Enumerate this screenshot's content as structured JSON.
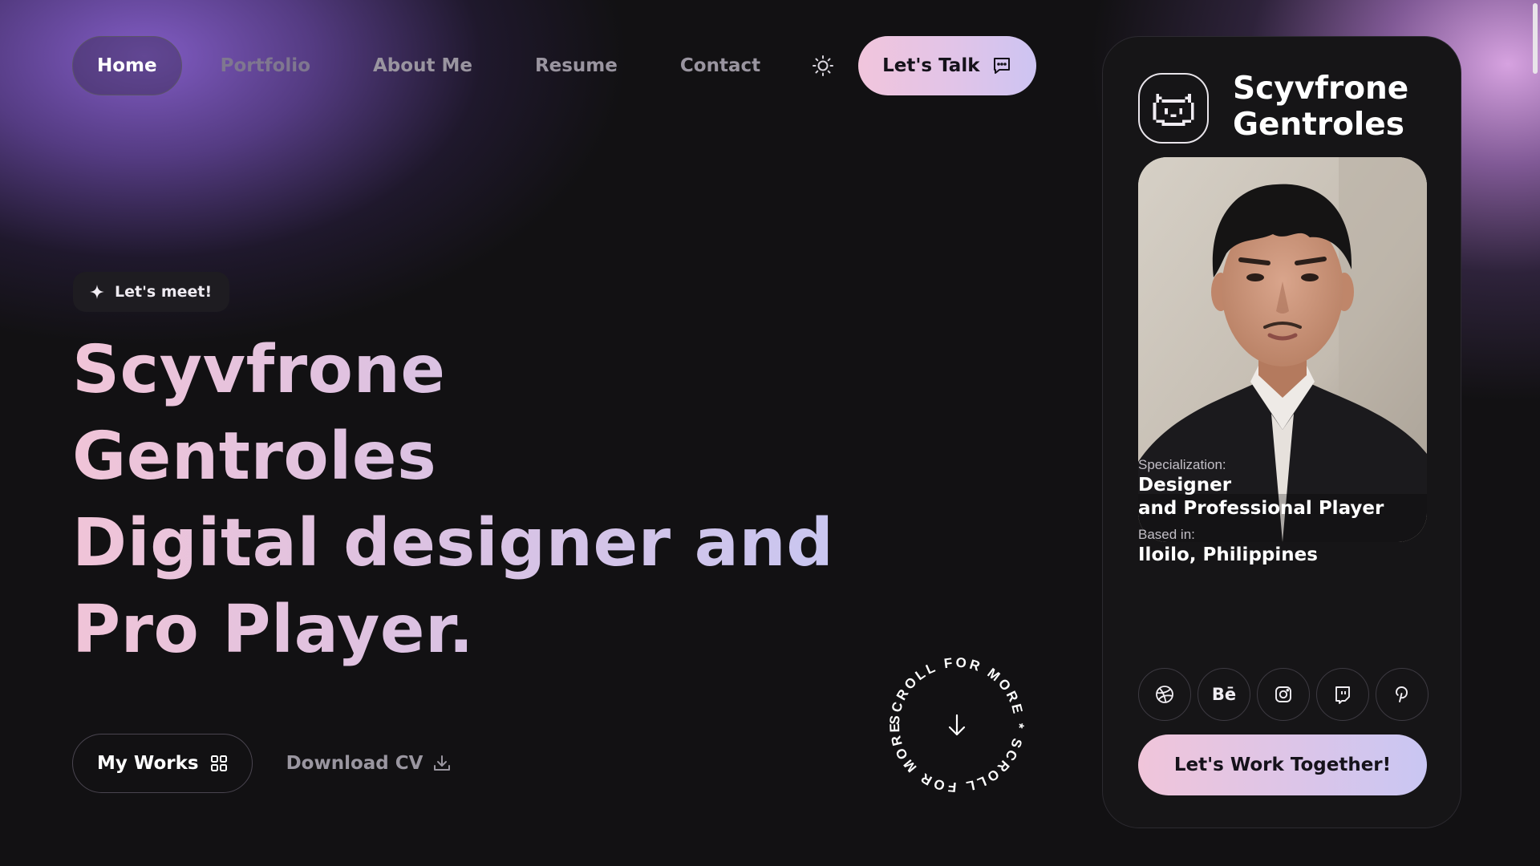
{
  "nav": {
    "items": [
      {
        "label": "Home",
        "active": true
      },
      {
        "label": "Portfolio",
        "active": false
      },
      {
        "label": "About Me",
        "active": false
      },
      {
        "label": "Resume",
        "active": false
      },
      {
        "label": "Contact",
        "active": false
      }
    ],
    "theme_icon": "sun-icon",
    "talk_label": "Let's Talk",
    "talk_icon": "chat-icon"
  },
  "hero": {
    "badge_label": "Let's meet!",
    "badge_icon": "sparkle-icon",
    "title_lines": [
      "Scyvfrone",
      "Gentroles",
      "Digital designer and",
      "Pro Player."
    ],
    "works_label": "My Works",
    "works_icon": "grid-icon",
    "cv_label": "Download CV",
    "cv_icon": "download-icon",
    "scroll_text": "SCROLL FOR MORE * SCROLL FOR MORE * ",
    "scroll_icon": "arrow-down-icon"
  },
  "card": {
    "logo_icon": "pixel-cat-icon",
    "name_lines": [
      "Scyvfrone",
      "Gentroles"
    ],
    "photo_icon": "profile-photo",
    "specialization_label": "Specialization:",
    "specialization_lines": [
      "Designer",
      "and Professional Player"
    ],
    "based_label": "Based in:",
    "based_value": "Iloilo, Philippines",
    "socials": [
      {
        "name": "dribbble",
        "icon": "dribbble-icon",
        "text": ""
      },
      {
        "name": "behance",
        "icon": "behance-icon",
        "text": "Bē"
      },
      {
        "name": "instagram",
        "icon": "instagram-icon",
        "text": ""
      },
      {
        "name": "twitch",
        "icon": "twitch-icon",
        "text": ""
      },
      {
        "name": "pinterest",
        "icon": "pinterest-icon",
        "text": ""
      }
    ],
    "cta_label": "Let's Work Together!"
  },
  "colors": {
    "background": "#121113",
    "accent_pink": "#f0c4d8",
    "accent_lavender": "#c9c6f0",
    "glow_purple": "#8760cd",
    "glow_pink": "#e1aaeb"
  }
}
